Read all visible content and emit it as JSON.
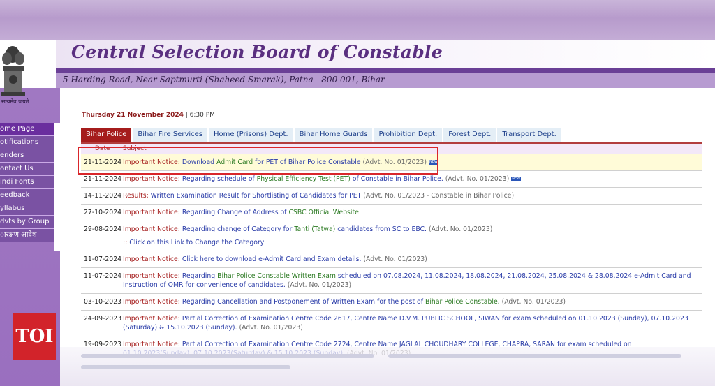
{
  "header": {
    "title": "Central Selection Board of Constable",
    "address": "5 Harding Road, Near Saptmurti (Shaheed Smarak), Patna - 800 001, Bihar",
    "emblem_caption": "सत्यमेव जयते"
  },
  "sidebar": {
    "items": [
      {
        "label": "ome Page",
        "active": true
      },
      {
        "label": "otifications"
      },
      {
        "label": "enders"
      },
      {
        "label": "ontact Us"
      },
      {
        "label": "indi Fonts"
      },
      {
        "label": "eedback"
      },
      {
        "label": "yllabus"
      },
      {
        "label": "dvts by Group"
      },
      {
        "label": "ारक्षण आदेश"
      }
    ]
  },
  "datetime": {
    "day": "Thursday 21 November 2024",
    "time": "6:30 PM"
  },
  "tabs": [
    {
      "label": "Bihar Police",
      "active": true
    },
    {
      "label": "Bihar Fire Services"
    },
    {
      "label": "Home (Prisons) Dept."
    },
    {
      "label": "Bihar Home Guards"
    },
    {
      "label": "Prohibition Dept."
    },
    {
      "label": "Forest Dept."
    },
    {
      "label": "Transport Dept."
    }
  ],
  "table_headers": {
    "date": "Date",
    "subject": "Subject"
  },
  "rows": [
    {
      "date": "21-11-2024",
      "prefix": "Important Notice:",
      "parts": [
        [
          "lnk",
          "Download "
        ],
        [
          "grn",
          "Admit Card"
        ],
        [
          "lnk",
          " for PET of Bihar Police Constable"
        ]
      ],
      "suffix": "(Advt. No. 01/2023)",
      "new": true,
      "highlight": true
    },
    {
      "date": "21-11-2024",
      "prefix": "Important Notice:",
      "parts": [
        [
          "lnk",
          "Regarding schedule of "
        ],
        [
          "grn",
          "Physical Efficiency Test (PET)"
        ],
        [
          "lnk",
          " of Constable in Bihar Police."
        ]
      ],
      "suffix": "(Advt. No. 01/2023)",
      "new": true
    },
    {
      "date": "14-11-2024",
      "prefix": "Results:",
      "parts": [
        [
          "lnk",
          "Written Examination Result for Shortlisting of Candidates for PET"
        ]
      ],
      "suffix": "(Advt. No. 01/2023 - Constable in Bihar Police)"
    },
    {
      "date": "27-10-2024",
      "prefix": "Important Notice:",
      "parts": [
        [
          "lnk",
          "Regarding Change of Address of "
        ],
        [
          "grn",
          "CSBC Official Website"
        ]
      ],
      "suffix": ""
    },
    {
      "date": "29-08-2024",
      "prefix": "Important Notice:",
      "parts": [
        [
          "lnk",
          "Regarding change of Category for "
        ],
        [
          "grn",
          "Tanti (Tatwa)"
        ],
        [
          "lnk",
          " candidates from SC to EBC."
        ]
      ],
      "suffix": "(Advt. No. 01/2023)",
      "sub": {
        "marker": "::",
        "text": "Click on this Link to Change the Category"
      }
    },
    {
      "date": "11-07-2024",
      "prefix": "Important Notice:",
      "parts": [
        [
          "lnk",
          "Click here to download e-Admit Card and Exam details."
        ]
      ],
      "suffix": "(Advt. No. 01/2023)"
    },
    {
      "date": "11-07-2024",
      "prefix": "Important Notice:",
      "parts": [
        [
          "lnk",
          "Regarding "
        ],
        [
          "grn",
          "Bihar Police Constable Written Exam"
        ],
        [
          "lnk",
          " scheduled on 07.08.2024, 11.08.2024, 18.08.2024, 21.08.2024, 25.08.2024 & 28.08.2024 e-Admit Card and Instruction of OMR for convenience of candidates."
        ]
      ],
      "suffix": "(Advt. No. 01/2023)"
    },
    {
      "date": "03-10-2023",
      "prefix": "Important Notice:",
      "parts": [
        [
          "lnk",
          "Regarding Cancellation and Postponement of Written Exam for the post of "
        ],
        [
          "grn",
          "Bihar Police Constable."
        ]
      ],
      "suffix": "(Advt. No. 01/2023)"
    },
    {
      "date": "24-09-2023",
      "prefix": "Important Notice:",
      "parts": [
        [
          "lnk",
          "Partial Correction of Examination Centre Code 2617, Centre Name D.V.M. PUBLIC SCHOOL, SIWAN for exam scheduled on 01.10.2023 (Sunday), 07.10.2023 (Saturday) & 15.10.2023 (Sunday)."
        ]
      ],
      "suffix": "(Advt. No. 01/2023)"
    },
    {
      "date": "19-09-2023",
      "prefix": "Important Notice:",
      "parts": [
        [
          "lnk",
          "Partial Correction of Examination Centre Code 2724, Centre Name JAGLAL CHOUDHARY COLLEGE, CHAPRA, SARAN for exam scheduled on 01.10.2023(Sunday), 07.10.2023(Saturday) & 15.10.2023 (Sunday)."
        ]
      ],
      "suffix": "(Advt. No. 01/2023)"
    }
  ],
  "badge_new": "NEW",
  "watermark": "TOI",
  "colors": {
    "brand_purple": "#6a3f96",
    "notice_red": "#a51c1c",
    "link_blue": "#2a3ca8",
    "highlight_red": "#d9262b"
  }
}
